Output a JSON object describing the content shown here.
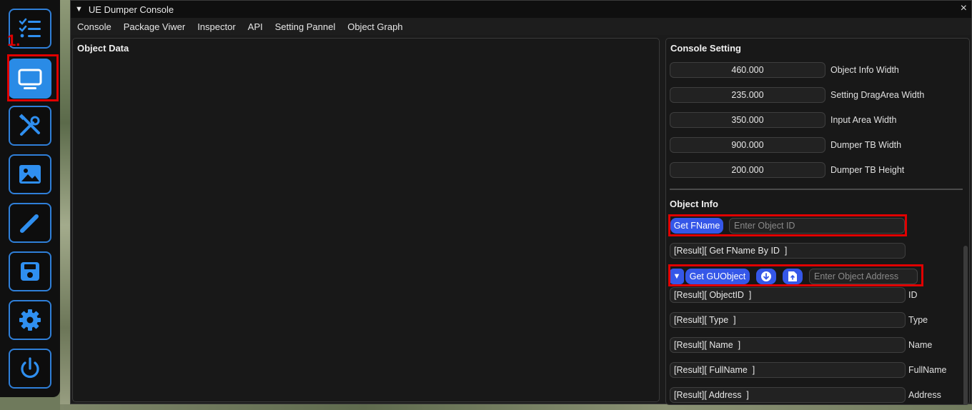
{
  "sidebar": {
    "step_label": "1.",
    "items": [
      {
        "name": "checklist",
        "icon": "checklist-icon"
      },
      {
        "name": "monitor",
        "icon": "monitor-icon"
      },
      {
        "name": "tools",
        "icon": "tools-icon"
      },
      {
        "name": "image",
        "icon": "image-icon"
      },
      {
        "name": "pen",
        "icon": "pen-icon"
      },
      {
        "name": "save",
        "icon": "save-icon"
      },
      {
        "name": "settings",
        "icon": "gear-icon"
      },
      {
        "name": "power",
        "icon": "power-icon"
      }
    ]
  },
  "window": {
    "title": "UE Dumper Console",
    "close_glyph": "×",
    "collapse_glyph": "▼"
  },
  "menu": [
    "Console",
    "Package Viwer",
    "Inspector",
    "API",
    "Setting Pannel",
    "Object Graph"
  ],
  "object_data": {
    "title": "Object Data"
  },
  "console_setting": {
    "title": "Console Setting",
    "rows": [
      {
        "value": "460.000",
        "label": "Object Info Width"
      },
      {
        "value": "235.000",
        "label": "Setting DragArea Width"
      },
      {
        "value": "350.000",
        "label": "Input Area Width"
      },
      {
        "value": "900.000",
        "label": "Dumper TB Width"
      },
      {
        "value": "200.000",
        "label": "Dumper TB Height"
      }
    ]
  },
  "object_info": {
    "title": "Object Info",
    "get_fname_label": "Get FName",
    "object_id_placeholder": "Enter Object ID",
    "fname_result": "[Result][ Get FName By ID  ]",
    "dropdown_glyph": "▼",
    "get_guobject_label": "Get GUObject",
    "object_address_placeholder": "Enter Object Address",
    "results": [
      {
        "value": "[Result][ ObjectID  ]",
        "label": "ID"
      },
      {
        "value": "[Result][ Type  ]",
        "label": "Type"
      },
      {
        "value": "[Result][ Name  ]",
        "label": "Name"
      },
      {
        "value": "[Result][ FullName  ]",
        "label": "FullName"
      },
      {
        "value": "[Result][ Address  ]",
        "label": "Address"
      }
    ]
  },
  "colors": {
    "accent_blue": "#3557e8",
    "sidebar_border": "#2f7fd8",
    "highlight_red": "#e00000"
  }
}
